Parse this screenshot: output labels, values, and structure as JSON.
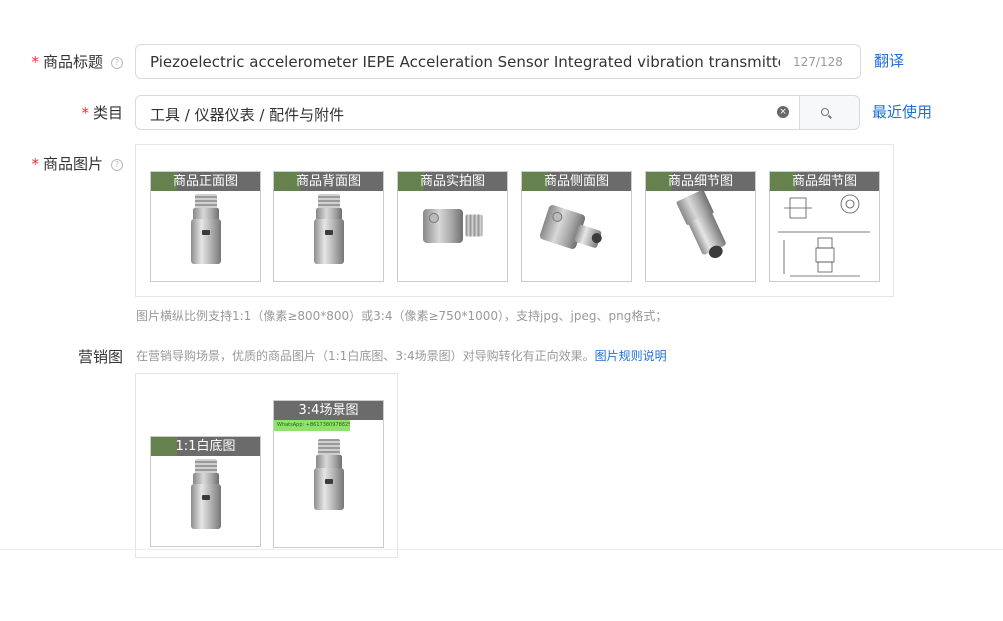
{
  "title_field": {
    "label": "商品标题",
    "value": "Piezoelectric accelerometer IEPE Acceleration Sensor Integrated vibration transmitter  Used",
    "counter": "127/128",
    "action": "翻译"
  },
  "category_field": {
    "label": "类目",
    "value": "工具 / 仪器仪表 / 配件与附件",
    "action": "最近使用"
  },
  "images_field": {
    "label": "商品图片",
    "thumbnails": [
      {
        "caption": "商品正面图"
      },
      {
        "caption": "商品背面图"
      },
      {
        "caption": "商品实拍图"
      },
      {
        "caption": "商品侧面图"
      },
      {
        "caption": "商品细节图"
      },
      {
        "caption": "商品细节图"
      }
    ],
    "hint": "图片横纵比例支持1:1（像素≥800*800）或3:4（像素≥750*1000），支持jpg、jpeg、png格式；"
  },
  "marketing_field": {
    "label": "营销图",
    "hint": "在营销导购场景，优质的商品图片（1:1白底图、3:4场景图）对导购转化有正向效果。",
    "hint_link": "图片规则说明",
    "thumbnails": [
      {
        "caption": "1:1白底图"
      },
      {
        "caption": "3:4场景图",
        "watermark": "WhatsApp: +8617380978825"
      }
    ]
  },
  "colors": {
    "required_star": "#ee3333",
    "link": "#1f6fd6",
    "caption_bg": "#6b6b6b"
  }
}
